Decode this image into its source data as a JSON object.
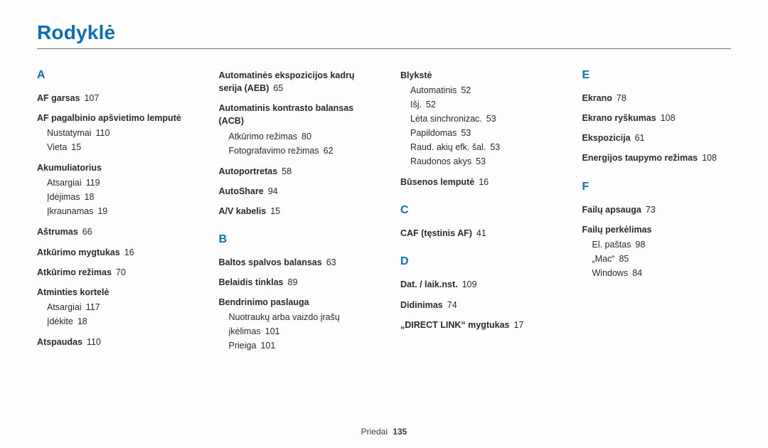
{
  "title": "Rodyklė",
  "footer": {
    "label": "Priedai",
    "page": "135"
  },
  "cols": [
    {
      "letters": [
        {
          "letter": "A",
          "secs": [
            {
              "h": "AF garsas",
              "pg": "107"
            },
            {
              "h": "AF pagalbinio apšvietimo lemputė",
              "subs": [
                {
                  "t": "Nustatymai",
                  "pg": "110"
                },
                {
                  "t": "Vieta",
                  "pg": "15"
                }
              ]
            },
            {
              "h": "Akumuliatorius",
              "subs": [
                {
                  "t": "Atsargiai",
                  "pg": "119"
                },
                {
                  "t": "Įdėjimas",
                  "pg": "18"
                },
                {
                  "t": "Įkraunamas",
                  "pg": "19"
                }
              ]
            },
            {
              "h": "Aštrumas",
              "pg": "66"
            },
            {
              "h": "Atkūrimo mygtukas",
              "pg": "16"
            },
            {
              "h": "Atkūrimo režimas",
              "pg": "70"
            },
            {
              "h": "Atminties kortelė",
              "subs": [
                {
                  "t": "Atsargiai",
                  "pg": "117"
                },
                {
                  "t": "Įdėkite",
                  "pg": "18"
                }
              ]
            },
            {
              "h": "Atspaudas",
              "pg": "110"
            }
          ]
        }
      ]
    },
    {
      "letters": [
        {
          "continued": true,
          "secs": [
            {
              "h": "Automatinės ekspozicijos kadrų serija (AEB)",
              "pg": "65"
            },
            {
              "h": "Automatinis kontrasto balansas (ACB)",
              "subs": [
                {
                  "t": "Atkūrimo režimas",
                  "pg": "80"
                },
                {
                  "t": "Fotografavimo režimas",
                  "pg": "62"
                }
              ]
            },
            {
              "h": "Autoportretas",
              "pg": "58"
            },
            {
              "h": "AutoShare",
              "pg": "94"
            },
            {
              "h": "A/V kabelis",
              "pg": "15"
            }
          ]
        },
        {
          "letter": "B",
          "secs": [
            {
              "h": "Baltos spalvos balansas",
              "pg": "63"
            },
            {
              "h": "Belaidis tinklas",
              "pg": "89"
            },
            {
              "h": "Bendrinimo paslauga",
              "subs": [
                {
                  "t": "Nuotraukų arba vaizdo įrašų įkėlimas",
                  "pg": "101"
                },
                {
                  "t": "Prieiga",
                  "pg": "101"
                }
              ]
            }
          ]
        }
      ]
    },
    {
      "letters": [
        {
          "continued": true,
          "secs": [
            {
              "h": "Blykstė",
              "subs": [
                {
                  "t": "Automatinis",
                  "pg": "52"
                },
                {
                  "t": "Išj.",
                  "pg": "52"
                },
                {
                  "t": "Lėta sinchronizac.",
                  "pg": "53"
                },
                {
                  "t": "Papildomas",
                  "pg": "53"
                },
                {
                  "t": "Raud. akių efk. šal.",
                  "pg": "53"
                },
                {
                  "t": "Raudonos akys",
                  "pg": "53"
                }
              ]
            },
            {
              "h": "Būsenos lemputė",
              "pg": "16"
            }
          ]
        },
        {
          "letter": "C",
          "secs": [
            {
              "h": "CAF (tęstinis AF)",
              "pg": "41"
            }
          ]
        },
        {
          "letter": "D",
          "secs": [
            {
              "h": "Dat. / laik.nst.",
              "pg": "109"
            },
            {
              "h": "Didinimas",
              "pg": "74"
            },
            {
              "h": "„DIRECT LINK“ mygtukas",
              "pg": "17"
            }
          ]
        }
      ]
    },
    {
      "letters": [
        {
          "letter": "E",
          "secs": [
            {
              "h": "Ekrano",
              "pg": "78"
            },
            {
              "h": "Ekrano ryškumas",
              "pg": "108"
            },
            {
              "h": "Ekspozicija",
              "pg": "61"
            },
            {
              "h": "Energijos taupymo režimas",
              "pg": "108"
            }
          ]
        },
        {
          "letter": "F",
          "secs": [
            {
              "h": "Failų apsauga",
              "pg": "73"
            },
            {
              "h": "Failų perkėlimas",
              "subs": [
                {
                  "t": "El. paštas",
                  "pg": "98"
                },
                {
                  "t": "„Mac“",
                  "pg": "85"
                },
                {
                  "t": "Windows",
                  "pg": "84"
                }
              ]
            }
          ]
        }
      ]
    }
  ]
}
